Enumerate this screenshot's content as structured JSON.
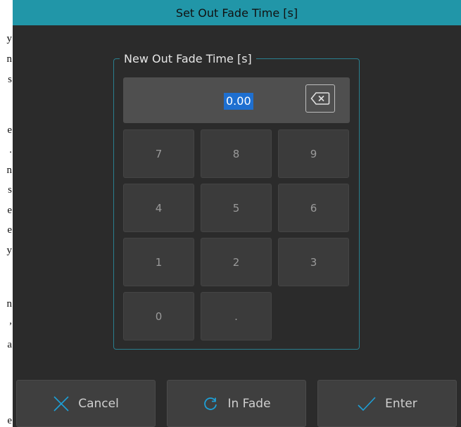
{
  "background_doc": {
    "fragments": [
      "y",
      "n",
      "s",
      "e",
      ".",
      "n",
      "s",
      "e",
      "e",
      "y",
      "n",
      ",",
      "a",
      "e"
    ]
  },
  "dialog": {
    "title": "Set Out Fade Time [s]",
    "group_label": "New Out Fade Time [s]",
    "display_value": "0.00",
    "keypad": {
      "keys": [
        "7",
        "8",
        "9",
        "4",
        "5",
        "6",
        "1",
        "2",
        "3",
        "0",
        "."
      ]
    },
    "buttons": {
      "cancel": "Cancel",
      "in_fade": "In Fade",
      "enter": "Enter"
    },
    "icons": {
      "backspace": "backspace-icon",
      "cancel": "x-icon",
      "in_fade": "refresh-icon",
      "enter": "checkmark-icon"
    },
    "colors": {
      "title_bar": "#2196a8",
      "accent_icon": "#1e9fd6",
      "selection": "#1e6fd0",
      "dialog_bg": "#2b2b2b"
    }
  }
}
